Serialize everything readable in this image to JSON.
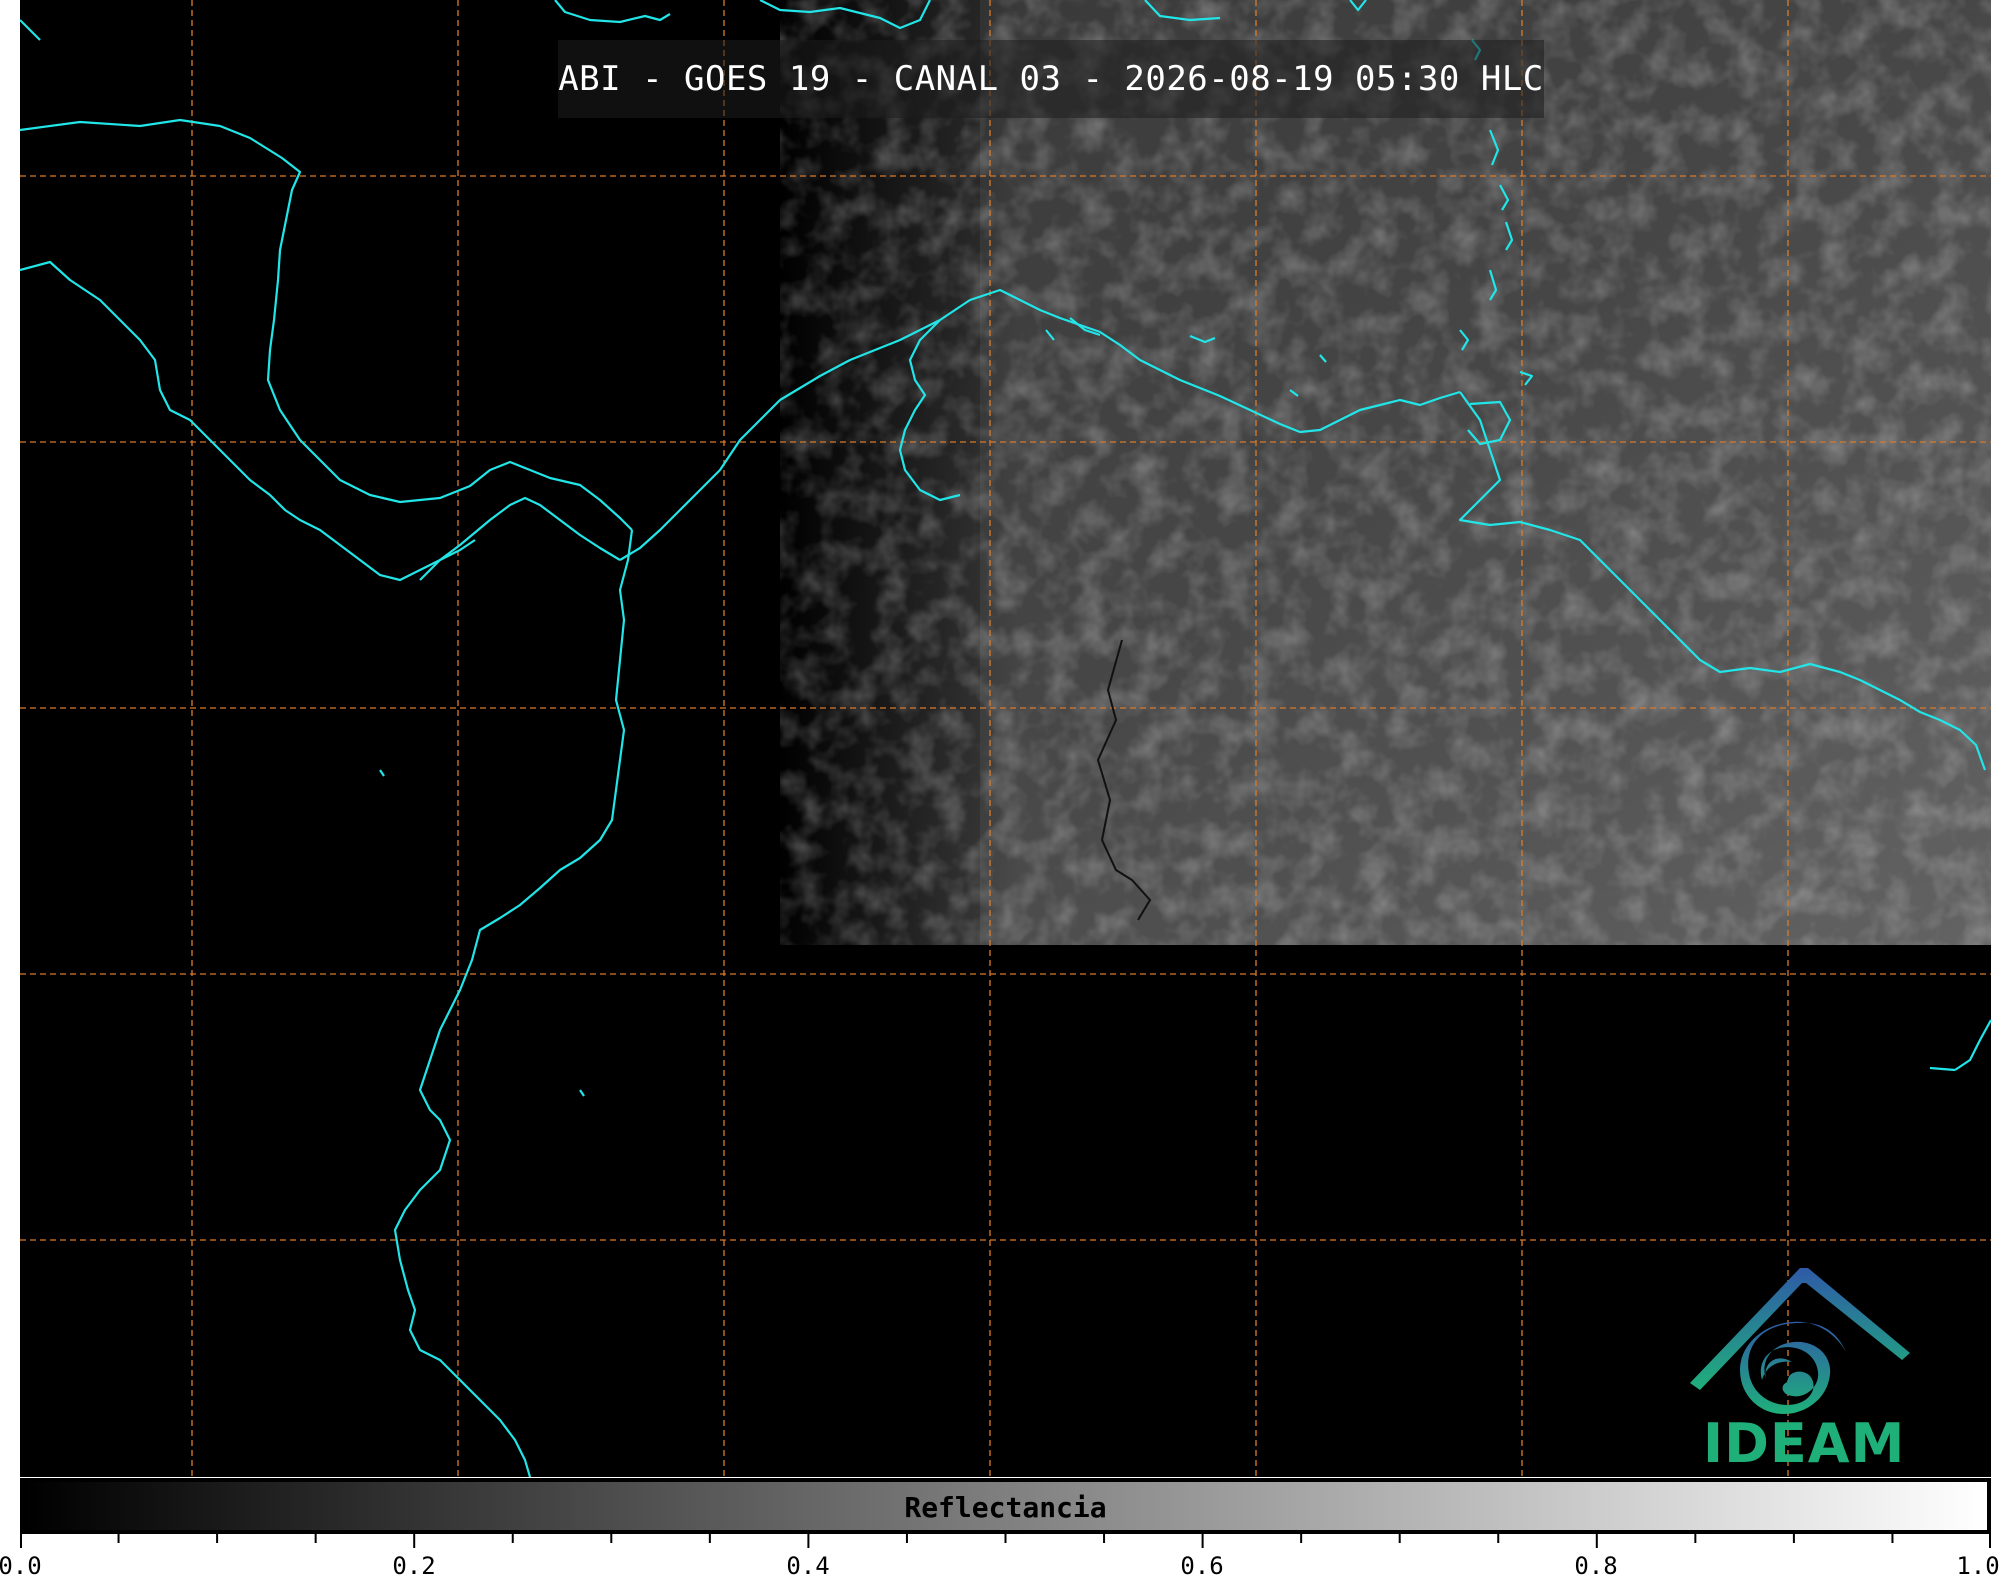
{
  "title": "ABI - GOES 19 - CANAL 03 - 2026-08-19 05:30 HLC",
  "logo": {
    "text": "IDEAM",
    "colors": {
      "blue": "#2a6ea8",
      "teal": "#1fb07a"
    }
  },
  "map": {
    "colors": {
      "background": "#000000",
      "coastline": "#22e5e8",
      "gridline": "#d97a2b",
      "land_border": "#111111"
    },
    "grid": true
  },
  "colorbar": {
    "label": "Reflectancia",
    "colormap": [
      "#000000",
      "#ffffff"
    ],
    "tick_labels": [
      "0.0",
      "0.2",
      "0.4",
      "0.6",
      "0.8",
      "1.0"
    ],
    "range": [
      0.0,
      1.0
    ]
  }
}
